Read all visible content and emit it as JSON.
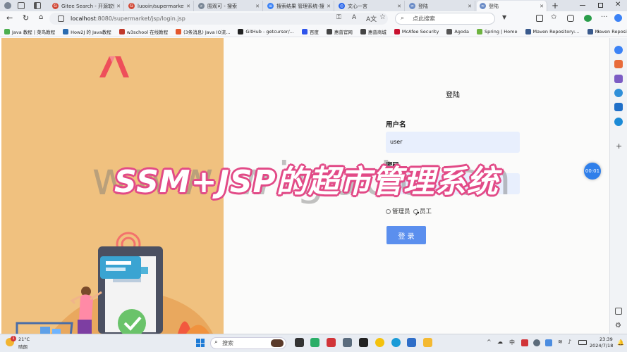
{
  "browser": {
    "tabs": [
      {
        "title": "Gitee Search - 开源软件 ·",
        "color": "#d14836",
        "glyph": "G"
      },
      {
        "title": "luooin/supermarket - 超",
        "color": "#d14836",
        "glyph": "G"
      },
      {
        "title": "围观可 - 搜索",
        "color": "#7a8796",
        "glyph": "⌕"
      },
      {
        "title": "搜索结果 管理系统-搜原",
        "color": "#3b82f6",
        "glyph": "≡"
      },
      {
        "title": "文心一言",
        "color": "#2563eb",
        "glyph": "◎"
      },
      {
        "title": "登陆",
        "color": "#6b8cc7",
        "glyph": "∞"
      },
      {
        "title": "登陆",
        "color": "#6b8cc7",
        "glyph": "∞"
      }
    ],
    "new_tab": "+",
    "url_host": "localhost",
    "url_path": ":8080/supermarket/jsp/login.jsp",
    "search_placeholder": "点此搜索",
    "bookmarks": [
      {
        "label": "Java 教程 | 菜鸟教程",
        "color": "#4caf50"
      },
      {
        "label": "How2J 的 Java教程",
        "color": "#2b6cb0"
      },
      {
        "label": "w3school 在线教程",
        "color": "#c0392b"
      },
      {
        "label": "(3条消息) Java IO流...",
        "color": "#e4572e"
      },
      {
        "label": "GitHub - getcursor/...",
        "color": "#222222"
      },
      {
        "label": "百度",
        "color": "#2f54eb"
      },
      {
        "label": "惠普官网",
        "color": "#444444"
      },
      {
        "label": "惠普商城",
        "color": "#444444"
      },
      {
        "label": "McAfee Security",
        "color": "#c8102e"
      },
      {
        "label": "Agoda",
        "color": "#555555"
      },
      {
        "label": "Spring | Home",
        "color": "#6db33f"
      },
      {
        "label": "Maven Repository:...",
        "color": "#3a5a8c"
      },
      {
        "label": "Maven Repository:...",
        "color": "#3a5a8c"
      }
    ],
    "more_bookmarks": "›"
  },
  "login": {
    "title": "登陆",
    "username_label": "用户名",
    "username_value": "user",
    "password_label": "密码",
    "password_value": "•••",
    "role_admin": "管理员",
    "role_staff": "员工",
    "submit": "登 录"
  },
  "overlay": {
    "title": "SSM+JSP的超市管理系统",
    "watermark": "www.wigodu.cn",
    "timer": "00:01"
  },
  "taskbar": {
    "weather_temp": "21°C",
    "weather_desc": "晴朗",
    "weather_badge": "1",
    "search_placeholder": "搜索",
    "time": "23:39",
    "date": "2024/7/18"
  }
}
